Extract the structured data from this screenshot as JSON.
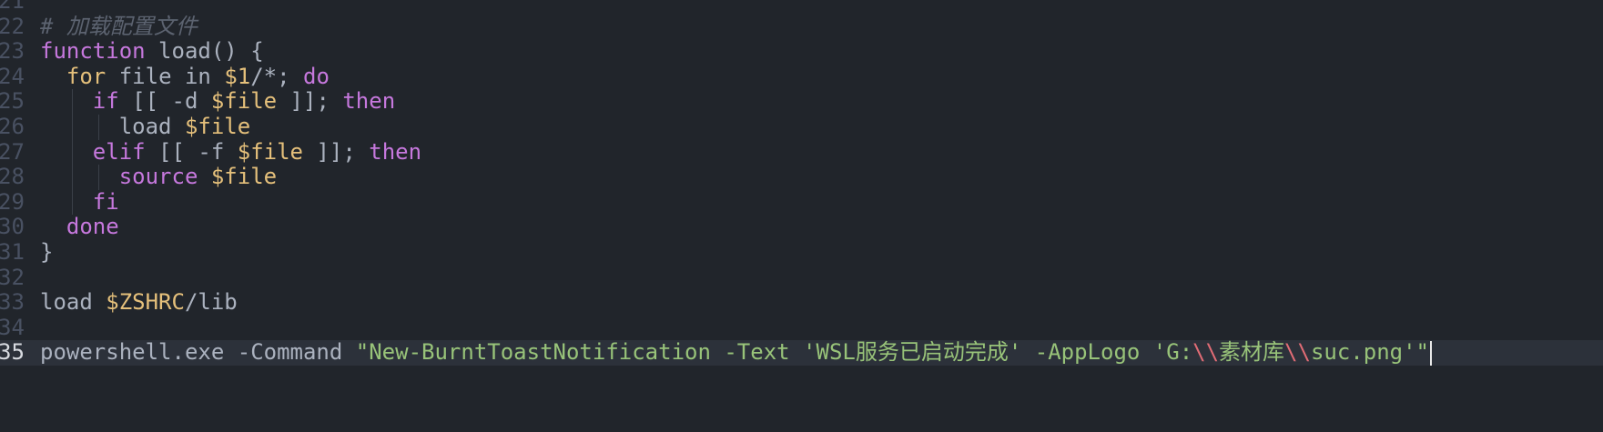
{
  "editor": {
    "language": "shell",
    "colors": {
      "background": "#21252b",
      "active_line": "#2c313a",
      "comment": "#5c6370",
      "keyword": "#c678dd",
      "variable": "#e5c07b",
      "string": "#98c379",
      "escape": "#e06c75",
      "text": "#abb2bf"
    },
    "lines": [
      {
        "number": "21",
        "tokens": []
      },
      {
        "number": "22",
        "tokens": [
          {
            "t": "comment",
            "v": "# 加载配置文件"
          }
        ]
      },
      {
        "number": "23",
        "tokens": [
          {
            "t": "keyword",
            "v": "function"
          },
          {
            "t": "text",
            "v": " load() {"
          }
        ]
      },
      {
        "number": "24",
        "tokens": [
          {
            "t": "text",
            "v": "  "
          },
          {
            "t": "for",
            "v": "for"
          },
          {
            "t": "text",
            "v": " file in "
          },
          {
            "t": "var",
            "v": "$1"
          },
          {
            "t": "text",
            "v": "/*; "
          },
          {
            "t": "keyword",
            "v": "do"
          }
        ]
      },
      {
        "number": "25",
        "tokens": [
          {
            "t": "text",
            "v": "    "
          },
          {
            "t": "keyword",
            "v": "if"
          },
          {
            "t": "text",
            "v": " [[ -d "
          },
          {
            "t": "var",
            "v": "$file"
          },
          {
            "t": "text",
            "v": " ]]; "
          },
          {
            "t": "keyword",
            "v": "then"
          }
        ]
      },
      {
        "number": "26",
        "tokens": [
          {
            "t": "text",
            "v": "      load "
          },
          {
            "t": "var",
            "v": "$file"
          }
        ]
      },
      {
        "number": "27",
        "tokens": [
          {
            "t": "text",
            "v": "    "
          },
          {
            "t": "keyword",
            "v": "elif"
          },
          {
            "t": "text",
            "v": " [[ -f "
          },
          {
            "t": "var",
            "v": "$file"
          },
          {
            "t": "text",
            "v": " ]]; "
          },
          {
            "t": "keyword",
            "v": "then"
          }
        ]
      },
      {
        "number": "28",
        "tokens": [
          {
            "t": "text",
            "v": "      "
          },
          {
            "t": "keyword",
            "v": "source"
          },
          {
            "t": "text",
            "v": " "
          },
          {
            "t": "var",
            "v": "$file"
          }
        ]
      },
      {
        "number": "29",
        "tokens": [
          {
            "t": "text",
            "v": "    "
          },
          {
            "t": "keyword",
            "v": "fi"
          }
        ]
      },
      {
        "number": "30",
        "tokens": [
          {
            "t": "text",
            "v": "  "
          },
          {
            "t": "keyword",
            "v": "done"
          }
        ]
      },
      {
        "number": "31",
        "tokens": [
          {
            "t": "text",
            "v": "}"
          }
        ]
      },
      {
        "number": "32",
        "tokens": []
      },
      {
        "number": "33",
        "tokens": [
          {
            "t": "text",
            "v": "load "
          },
          {
            "t": "var",
            "v": "$ZSHRC"
          },
          {
            "t": "text",
            "v": "/lib"
          }
        ]
      },
      {
        "number": "34",
        "tokens": []
      },
      {
        "number": "35",
        "active": true,
        "tokens": [
          {
            "t": "text",
            "v": "powershell.exe -Command "
          },
          {
            "t": "string",
            "v": "\"New-BurntToastNotification -Text 'WSL服务已启动完成' -AppLogo 'G:"
          },
          {
            "t": "escape",
            "v": "\\\\"
          },
          {
            "t": "string",
            "v": "素材库"
          },
          {
            "t": "escape",
            "v": "\\\\"
          },
          {
            "t": "string",
            "v": "suc.png'\""
          }
        ]
      }
    ]
  }
}
